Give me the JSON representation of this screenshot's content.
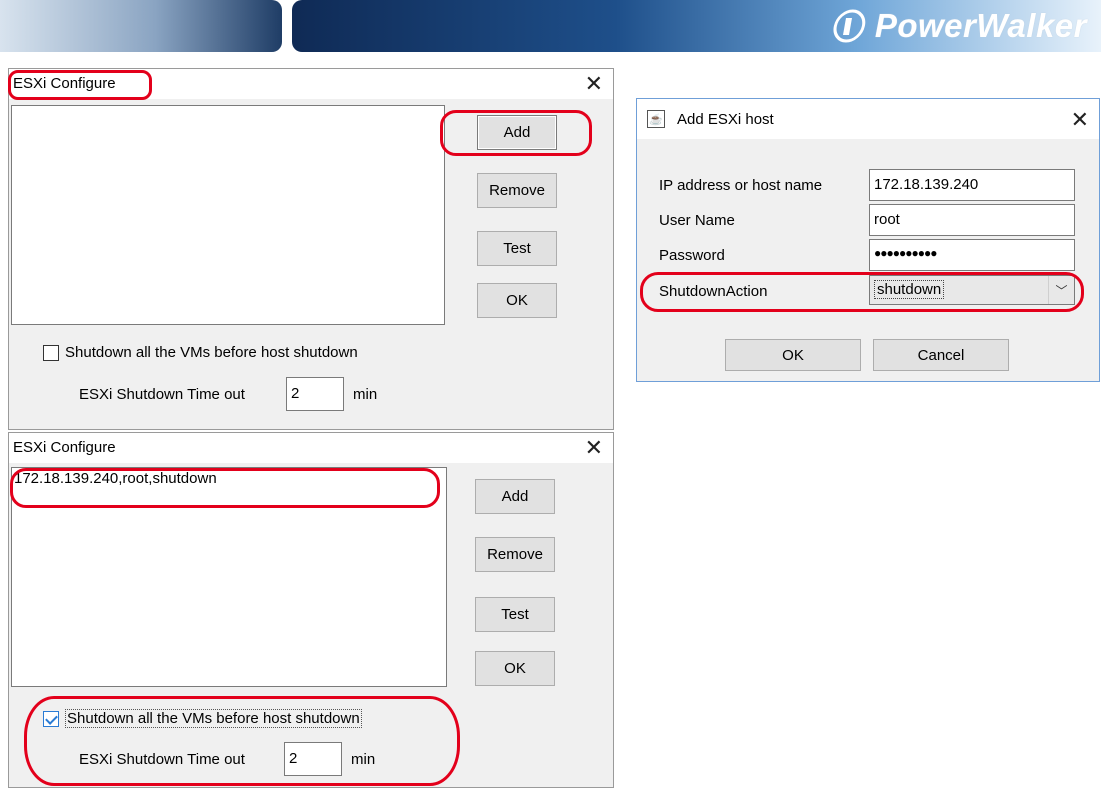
{
  "banner": {
    "brand_name": "PowerWalker",
    "brand_icon": "powerwalker-logo-icon"
  },
  "dialog_top": {
    "title": "ESXi Configure",
    "close_glyph": "✕",
    "list_items": [],
    "buttons": {
      "add": "Add",
      "remove": "Remove",
      "test": "Test",
      "ok": "OK"
    },
    "checkbox_label": "Shutdown all the VMs before host shutdown",
    "checkbox_checked": false,
    "timeout_label": "ESXi Shutdown Time out",
    "timeout_value": "2",
    "timeout_unit": "min"
  },
  "dialog_bottom": {
    "title": "ESXi Configure",
    "close_glyph": "✕",
    "list_items": [
      "172.18.139.240,root,shutdown"
    ],
    "buttons": {
      "add": "Add",
      "remove": "Remove",
      "test": "Test",
      "ok": "OK"
    },
    "checkbox_label": "Shutdown all the VMs before host shutdown",
    "checkbox_checked": true,
    "timeout_label": "ESXi Shutdown Time out",
    "timeout_value": "2",
    "timeout_unit": "min"
  },
  "add_host_dialog": {
    "title": "Add ESXi host",
    "close_glyph": "✕",
    "app_icon": "java-app-icon",
    "ip_label": "IP address or host name",
    "ip_value": "172.18.139.240",
    "user_label": "User Name",
    "user_value": "root",
    "password_label": "Password",
    "password_value": "●●●●●●●●●●",
    "action_label": "ShutdownAction",
    "action_value": "shutdown",
    "ok_label": "OK",
    "cancel_label": "Cancel"
  },
  "colors": {
    "highlight": "#e3001b",
    "dialog_bg": "#f0f0f0",
    "button_bg": "#e1e1e1",
    "checkbox_accent": "#2a7bd4"
  }
}
